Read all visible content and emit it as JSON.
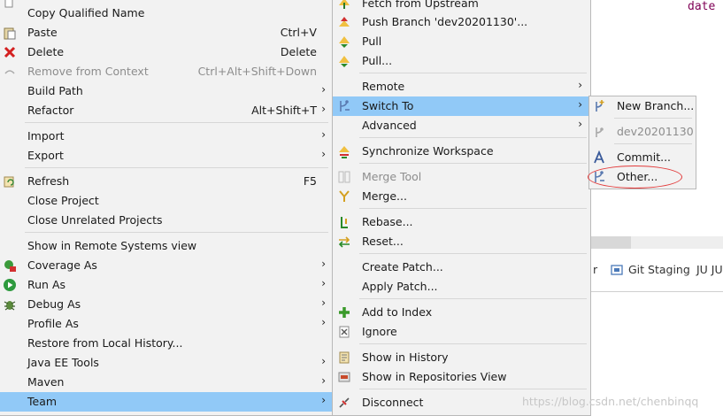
{
  "editor": {
    "code_fragment": "date"
  },
  "background": {
    "tab_fragment": "r",
    "tabs": [
      "Git Staging",
      "JU JU"
    ],
    "watermark": "https://blog.csdn.net/chenbinqq"
  },
  "main_menu": {
    "copy_qualified_name": "Copy Qualified Name",
    "paste": "Paste",
    "paste_shortcut": "Ctrl+V",
    "delete": "Delete",
    "delete_shortcut": "Delete",
    "remove_from_context": "Remove from Context",
    "remove_shortcut": "Ctrl+Alt+Shift+Down",
    "build_path": "Build Path",
    "refactor": "Refactor",
    "refactor_shortcut": "Alt+Shift+T",
    "import": "Import",
    "export": "Export",
    "refresh": "Refresh",
    "refresh_shortcut": "F5",
    "close_project": "Close Project",
    "close_unrelated_projects": "Close Unrelated Projects",
    "show_in_remote_systems": "Show in Remote Systems view",
    "coverage_as": "Coverage As",
    "run_as": "Run As",
    "debug_as": "Debug As",
    "profile_as": "Profile As",
    "restore_local_history": "Restore from Local History...",
    "java_ee_tools": "Java EE Tools",
    "maven": "Maven",
    "team": "Team"
  },
  "team_menu": {
    "fetch_from_upstream": "Fetch from Upstream",
    "push_branch": "Push Branch 'dev20201130'...",
    "pull": "Pull",
    "pull_dialog": "Pull...",
    "remote": "Remote",
    "switch_to": "Switch To",
    "advanced": "Advanced",
    "synchronize_workspace": "Synchronize Workspace",
    "merge_tool": "Merge Tool",
    "merge": "Merge...",
    "rebase": "Rebase...",
    "reset": "Reset...",
    "create_patch": "Create Patch...",
    "apply_patch": "Apply Patch...",
    "add_to_index": "Add to Index",
    "ignore": "Ignore",
    "show_in_history": "Show in History",
    "show_in_repositories_view": "Show in Repositories View",
    "disconnect": "Disconnect"
  },
  "switch_to_menu": {
    "new_branch": "New Branch...",
    "current_branch": "dev20201130",
    "commit": "Commit...",
    "other": "Other..."
  },
  "colors": {
    "highlight": "#91c9f7",
    "menu_bg": "#f2f2f2",
    "annotation": "#e23a3a"
  }
}
